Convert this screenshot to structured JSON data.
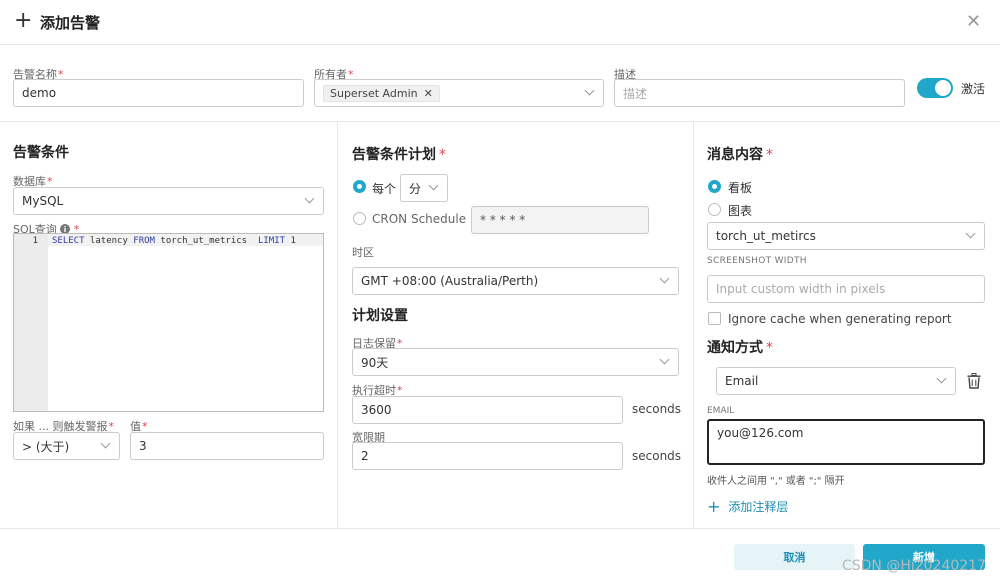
{
  "header": {
    "title": "添加告警",
    "plus_icon": "plus-icon",
    "close_icon": "close-icon"
  },
  "top": {
    "alert_name_label": "告警名称",
    "alert_name_value": "demo",
    "owners_label": "所有者",
    "owner_tag": "Superset Admin",
    "description_label": "描述",
    "description_placeholder": "描述",
    "active_label": "激活"
  },
  "left": {
    "section_title": "告警条件",
    "database_label": "数据库",
    "database_value": "MySQL",
    "sql_label": "SQL查询",
    "sql_line_number": "1",
    "sql_parts": [
      "SELECT",
      " latency ",
      "FROM",
      " torch_ut_metrics  ",
      "LIMIT",
      " 1"
    ],
    "trigger_label": "如果 ... 则触发警报",
    "trigger_value": "> (大于)",
    "value_label": "值",
    "value_value": "3"
  },
  "middle": {
    "section_title": "告警条件计划",
    "every_label": "每个",
    "every_unit": "分",
    "cron_label": "CRON Schedule",
    "cron_value": "* * * * *",
    "timezone_label": "时区",
    "timezone_value": "GMT +08:00 (Australia/Perth)",
    "plan_title": "计划设置",
    "log_retention_label": "日志保留",
    "log_retention_value": "90天",
    "timeout_label": "执行超时",
    "timeout_value": "3600",
    "timeout_unit": "seconds",
    "grace_label": "宽限期",
    "grace_value": "2",
    "grace_unit": "seconds"
  },
  "right": {
    "section_title": "消息内容",
    "dashboard_label": "看板",
    "chart_label": "图表",
    "chart_value": "torch_ut_metircs",
    "screenshot_width_label": "SCREENSHOT WIDTH",
    "screenshot_width_placeholder": "Input custom width in pixels",
    "ignore_cache_label": "Ignore cache when generating report",
    "notify_title": "通知方式",
    "notify_method": "Email",
    "email_label": "EMAIL",
    "email_value": "you@126.com",
    "email_hint": "收件人之间用 \",\" 或者 \";\" 隔开",
    "add_layer_label": "添加注释层"
  },
  "footer": {
    "cancel_label": "取消",
    "submit_label": "新增",
    "watermark": "CSDN @Hi20240217"
  },
  "colors": {
    "accent": "#20a7c9",
    "required": "#e04355"
  }
}
